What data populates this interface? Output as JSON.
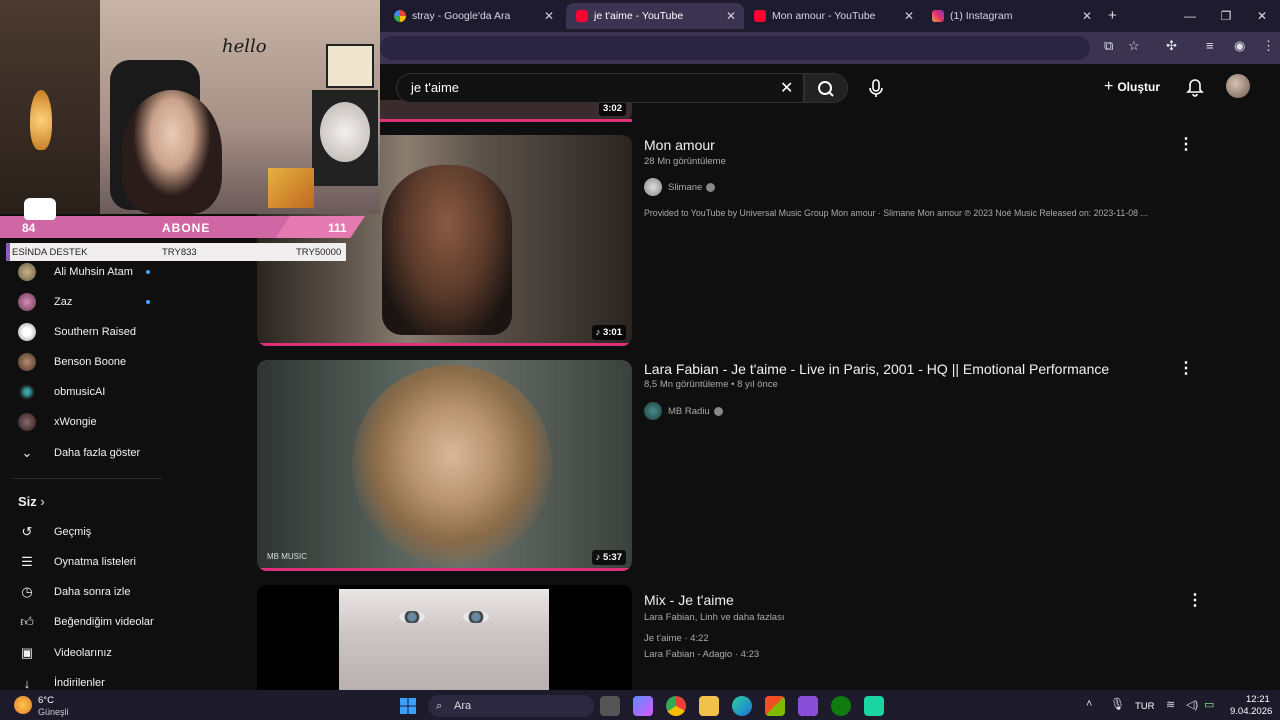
{
  "browser": {
    "tabs": [
      {
        "title": "stray - Google'da Ara",
        "icon": "google-icon",
        "active": false
      },
      {
        "title": "je t'aime - YouTube",
        "icon": "youtube-icon",
        "active": true
      },
      {
        "title": "Mon amour - YouTube",
        "icon": "youtube-icon",
        "active": false
      },
      {
        "title": "(1) Instagram",
        "icon": "instagram-icon",
        "active": false
      }
    ],
    "new_tab_label": "+"
  },
  "youtube": {
    "search_query": "je t'aime",
    "create_label": "Oluştur",
    "prev_duration": "3:02",
    "videos": [
      {
        "title": "Mon amour",
        "views": "28 Mn görüntüleme",
        "age": "",
        "channel": "Slimane",
        "description": "Provided to YouTube by Universal Music Group Mon amour · Slimane Mon amour ℗ 2023 Noé Music Released on: 2023-11-08 ...",
        "duration": "3:01"
      },
      {
        "title": "Lara Fabian - Je t'aime - Live in Paris, 2001 - HQ || Emotional Performance",
        "views": "8,5 Mn görüntüleme",
        "age": "• 8 yıl önce",
        "channel": "MB Radiu",
        "watermark": "MB MUSIC",
        "duration": "5:37"
      },
      {
        "title": "Mix - Je t'aime",
        "subtitle": "Lara Fabian, Linh ve daha fazlası",
        "tracks": [
          "Je t'aime · 4:22",
          "Lara Fabian - Adagio · 4:23"
        ]
      }
    ]
  },
  "sidebar": {
    "subscriptions": [
      {
        "label": "Ali Muhsin Atam",
        "dot": true
      },
      {
        "label": "Zaz",
        "dot": true
      },
      {
        "label": "Southern Raised",
        "dot": false
      },
      {
        "label": "Benson Boone",
        "dot": false
      },
      {
        "label": "obmusicAI",
        "dot": false
      },
      {
        "label": "xWongie",
        "dot": false
      }
    ],
    "show_more": "Daha fazla göster",
    "you_header": "Siz",
    "you_items": [
      {
        "label": "Geçmiş",
        "icon": "history-icon"
      },
      {
        "label": "Oynatma listeleri",
        "icon": "playlists-icon"
      },
      {
        "label": "Daha sonra izle",
        "icon": "watch-later-icon"
      },
      {
        "label": "Beğendiğim videolar",
        "icon": "liked-icon"
      },
      {
        "label": "Videolarınız",
        "icon": "your-videos-icon"
      },
      {
        "label": "İndirilenler",
        "icon": "downloads-icon"
      }
    ]
  },
  "overlay": {
    "abone_label": "ABONE",
    "abone_left": "84",
    "abone_right": "111",
    "destek_label": "ESİNDA DESTEK",
    "destek_mid": "TRY833",
    "destek_right": "TRY50000",
    "wall_text": "hello"
  },
  "taskbar": {
    "weather_temp": "6°C",
    "weather_text": "Güneşli",
    "search_label": "Ara",
    "lang": "TUR",
    "time": "12:21",
    "date": "9.04.2026"
  }
}
